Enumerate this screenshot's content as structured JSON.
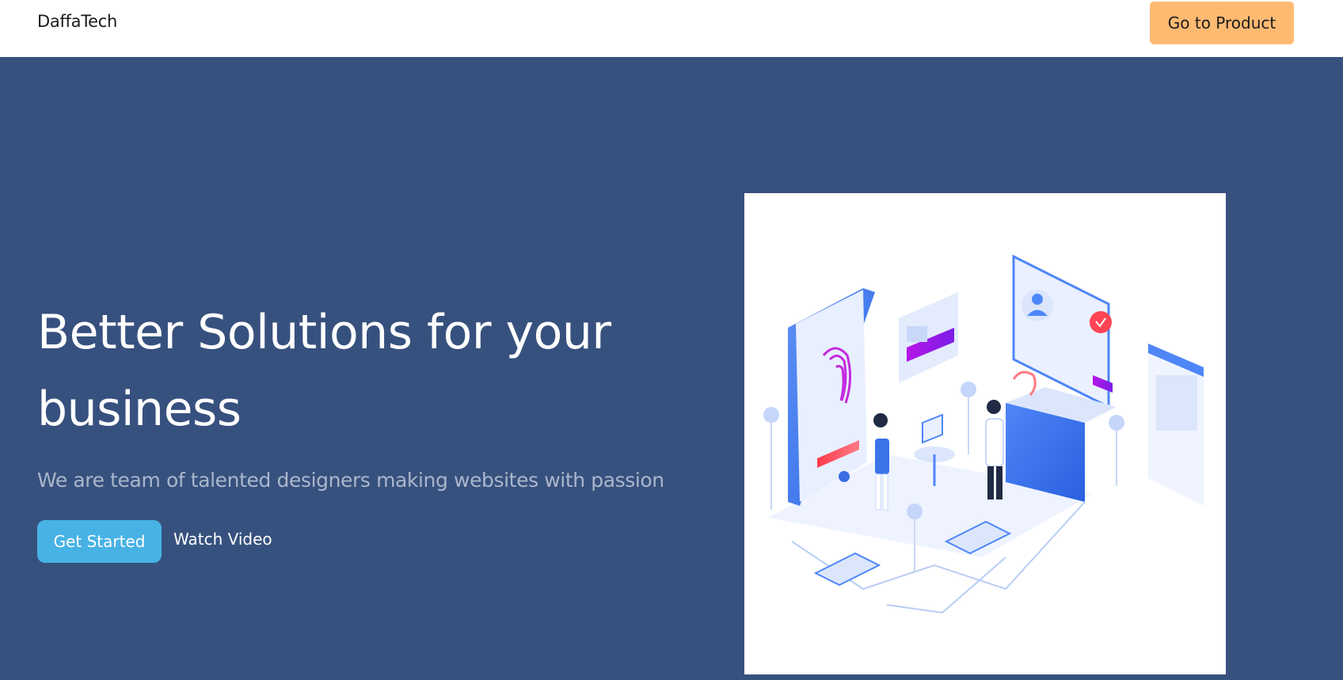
{
  "navbar": {
    "brand": "DaffaTech",
    "cta_label": "Go to Product"
  },
  "hero": {
    "title": "Better Solutions for your business",
    "subtitle": "We are team of talented designers making websites with passion",
    "primary_button": "Get Started",
    "secondary_link": "Watch Video",
    "illustration_icon": "security-isometric-illustration"
  },
  "colors": {
    "hero_bg": "#37517e",
    "cta_orange": "#ffba72",
    "primary_blue": "#47b2e4",
    "subtitle_gray": "#aab6cc"
  }
}
